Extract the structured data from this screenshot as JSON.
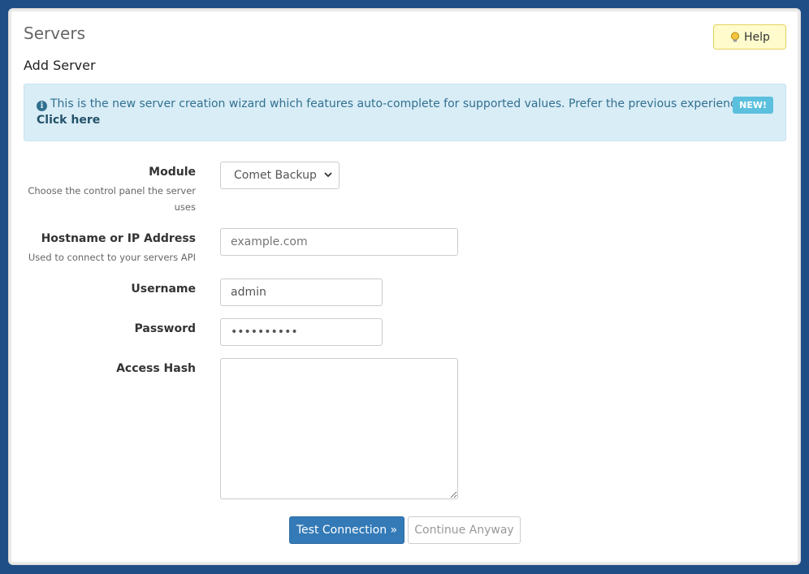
{
  "header": {
    "title": "Servers",
    "help_label": "Help",
    "subtitle": "Add Server"
  },
  "alert": {
    "text": "This is the new server creation wizard which features auto-complete for supported values. Prefer the previous experience?",
    "link_text": "Click here",
    "badge": "NEW!"
  },
  "form": {
    "module": {
      "label": "Module",
      "help": "Choose the control panel the server uses",
      "selected": "Comet Backup"
    },
    "hostname": {
      "label": "Hostname or IP Address",
      "help": "Used to connect to your servers API",
      "placeholder": "example.com"
    },
    "username": {
      "label": "Username",
      "value": "admin"
    },
    "password": {
      "label": "Password",
      "value": "••••••••••"
    },
    "access_hash": {
      "label": "Access Hash",
      "value": ""
    }
  },
  "actions": {
    "test_label": "Test Connection »",
    "continue_label": "Continue Anyway"
  },
  "colors": {
    "background": "#1f4e86",
    "primary": "#337ab7",
    "alert_bg": "#d9edf7",
    "help_bg": "#fffbcc"
  }
}
